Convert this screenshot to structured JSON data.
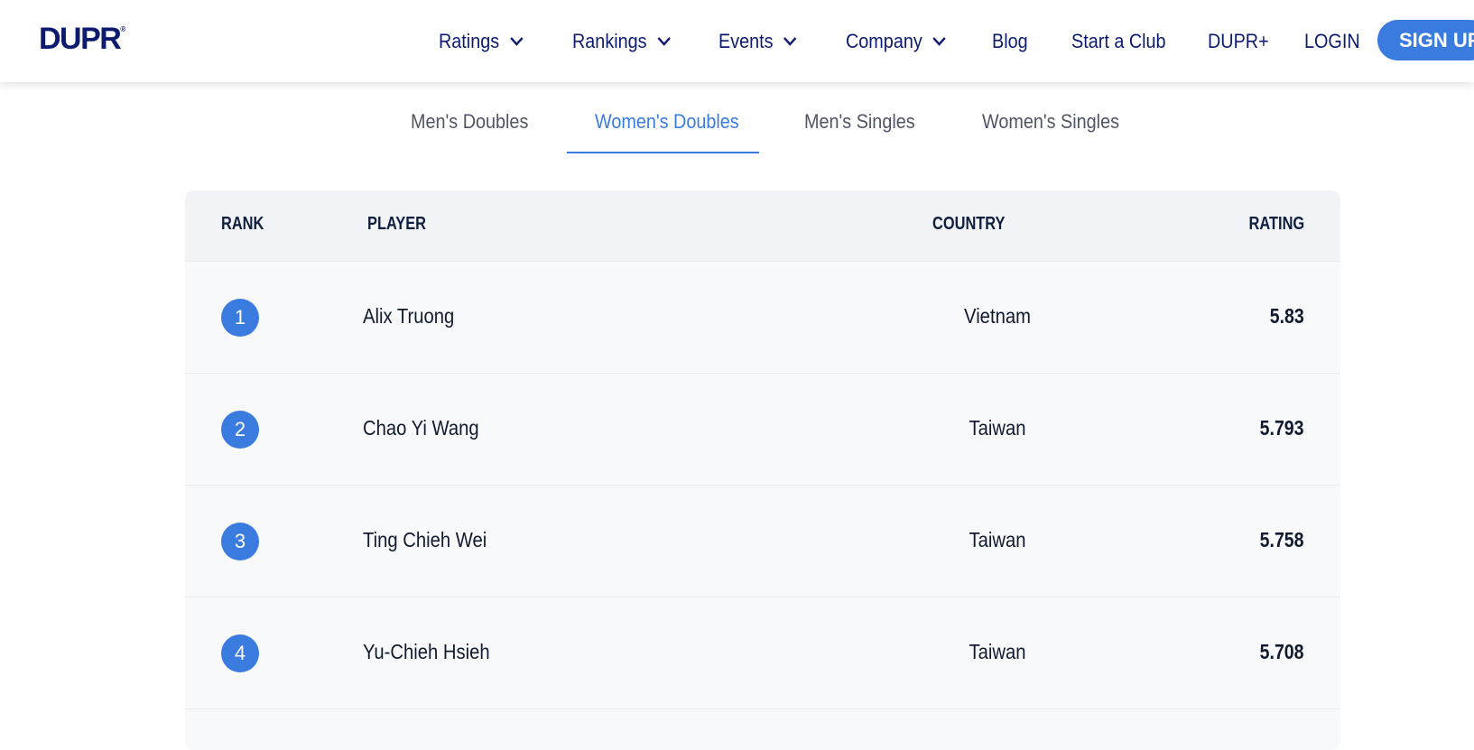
{
  "header": {
    "logo": "DUPR",
    "nav": [
      {
        "label": "Ratings",
        "has_dropdown": true
      },
      {
        "label": "Rankings",
        "has_dropdown": true
      },
      {
        "label": "Events",
        "has_dropdown": true
      },
      {
        "label": "Company",
        "has_dropdown": true
      },
      {
        "label": "Blog",
        "has_dropdown": false
      },
      {
        "label": "Start a Club",
        "has_dropdown": false
      },
      {
        "label": "DUPR+",
        "has_dropdown": false
      },
      {
        "label": "LOGIN",
        "has_dropdown": false
      }
    ],
    "signup_label": "SIGN UP"
  },
  "tabs": [
    {
      "label": "Men's Doubles",
      "active": false
    },
    {
      "label": "Women's Doubles",
      "active": true
    },
    {
      "label": "Men's Singles",
      "active": false
    },
    {
      "label": "Women's Singles",
      "active": false
    }
  ],
  "table": {
    "columns": {
      "rank": "RANK",
      "player": "PLAYER",
      "country": "COUNTRY",
      "rating": "RATING"
    },
    "rows": [
      {
        "rank": "1",
        "player": "Alix Truong",
        "country": "Vietnam",
        "rating": "5.83"
      },
      {
        "rank": "2",
        "player": "Chao Yi Wang",
        "country": "Taiwan",
        "rating": "5.793"
      },
      {
        "rank": "3",
        "player": "Ting Chieh Wei",
        "country": "Taiwan",
        "rating": "5.758"
      },
      {
        "rank": "4",
        "player": "Yu-Chieh Hsieh",
        "country": "Taiwan",
        "rating": "5.708"
      }
    ]
  },
  "colors": {
    "brand_navy": "#0d1b6e",
    "accent_blue": "#3a7be0",
    "table_bg": "#f8f9fb",
    "header_row_bg": "#f1f3f6"
  }
}
